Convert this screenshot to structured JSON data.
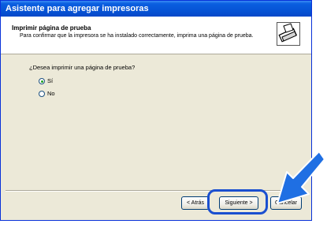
{
  "window": {
    "title": "Asistente para agregar impresoras"
  },
  "header": {
    "title": "Imprimir página de prueba",
    "subtitle": "Para confirmar que la impresora se ha instalado correctamente, imprima una página de prueba.",
    "icon": "printer-icon"
  },
  "body": {
    "question": "¿Desea imprimir una página de prueba?",
    "options": [
      {
        "label": "Sí",
        "selected": true
      },
      {
        "label": "No",
        "selected": false
      }
    ]
  },
  "buttons": {
    "back": "< Atrás",
    "next": "Siguiente >",
    "cancel": "Cancelar"
  },
  "colors": {
    "titlebar": "#0654d6",
    "highlight": "#1a4fd0"
  }
}
